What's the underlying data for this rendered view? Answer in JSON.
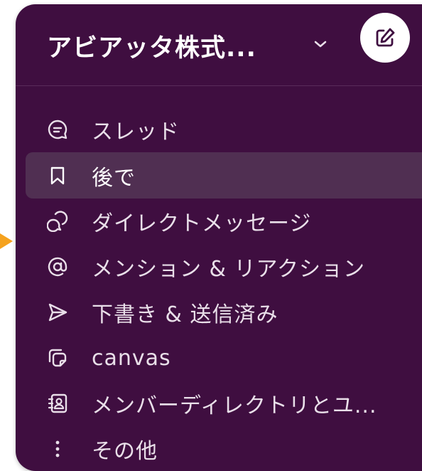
{
  "workspace": {
    "name": "アビアッタ株式...",
    "chevron_icon": "chevron-down-icon",
    "compose_icon": "compose-icon"
  },
  "nav": {
    "items": [
      {
        "label": "スレッド",
        "icon": "threads-icon"
      },
      {
        "label": "後で",
        "icon": "bookmark-icon",
        "active": true
      },
      {
        "label": "ダイレクトメッセージ",
        "icon": "direct-messages-icon"
      },
      {
        "label": "メンション & リアクション",
        "icon": "at-sign-icon"
      },
      {
        "label": "下書き & 送信済み",
        "icon": "send-icon"
      },
      {
        "label": "canvas",
        "icon": "canvas-icon"
      },
      {
        "label": "メンバーディレクトリとユ...",
        "icon": "member-directory-icon"
      },
      {
        "label": "その他",
        "icon": "more-vertical-icon"
      }
    ]
  },
  "colors": {
    "sidebar_bg": "#3f0e40",
    "active_item_bg": "#502f52",
    "text": "#e9dfe9",
    "pointer_arrow": "#f5a21e"
  }
}
